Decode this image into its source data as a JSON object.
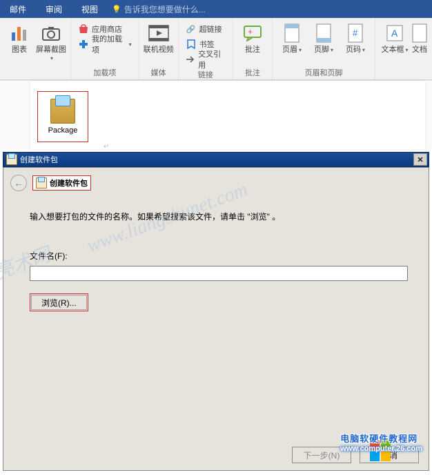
{
  "menubar": {
    "tabs": [
      "邮件",
      "审阅",
      "视图"
    ],
    "tell_me": "告诉我您想要做什么..."
  },
  "ribbon": {
    "chart": "图表",
    "screenshot": "屏幕截图",
    "store": "应用商店",
    "my_addins": "我的加载项",
    "group_addins": "加载项",
    "online_video": "联机视频",
    "group_media": "媒体",
    "hyperlink": "超链接",
    "bookmark": "书签",
    "crossref": "交叉引用",
    "group_links": "链接",
    "comment": "批注",
    "group_comment": "批注",
    "header": "页眉",
    "footer": "页脚",
    "page_number": "页码",
    "group_hf": "页眉和页脚",
    "textbox": "文本框",
    "wordart": "文档"
  },
  "object": {
    "caption": "Package"
  },
  "dialog": {
    "title": "创建软件包",
    "crumb": "创建软件包",
    "instruction": "输入想要打包的文件的名称。如果希望搜索该文件，请单击 \"浏览\" 。",
    "filename_label": "文件名(F):",
    "filename_value": "",
    "browse": "浏览(R)...",
    "next": "下一步(N)",
    "cancel": "取消"
  },
  "watermark": {
    "line1": "电脑软硬件教程网",
    "line2": "www.computer.26.com"
  }
}
